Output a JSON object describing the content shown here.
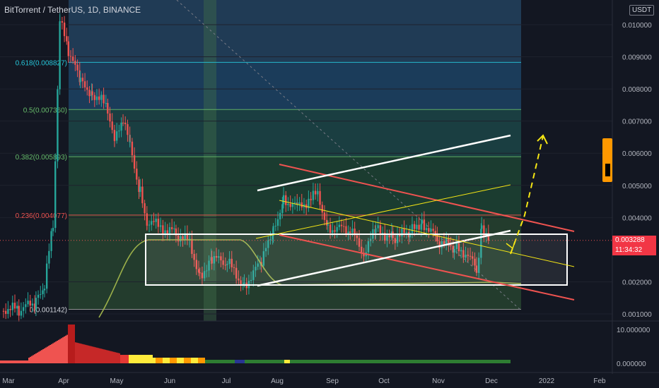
{
  "header": {
    "title": "BitTorrent / TetherUS, 1D, BINANCE",
    "quote_currency": "USDT"
  },
  "colors": {
    "background": "#131722",
    "grid": "#1e222d",
    "axis_text": "#b2b5be",
    "up": "#26a69a",
    "down": "#ef5350",
    "white": "#ffffff",
    "yellow": "#f5e614",
    "red": "#ef5350",
    "orange": "#ff9800"
  },
  "current_price": {
    "value": "0.003288",
    "countdown": "11:34:32"
  },
  "chart_data": {
    "type": "candlestick",
    "symbol": "BitTorrent / TetherUS",
    "interval": "1D",
    "exchange": "BINANCE",
    "y_axis": {
      "ticks": [
        "0.010000",
        "0.009000",
        "0.008000",
        "0.007000",
        "0.006000",
        "0.005000",
        "0.004000",
        "0.002000",
        "0.001000"
      ],
      "range": [
        0.0008,
        0.0104
      ]
    },
    "x_axis": {
      "ticks": [
        "Mar",
        "Apr",
        "May",
        "Jun",
        "Jul",
        "Aug",
        "Sep",
        "Oct",
        "Nov",
        "Dec",
        "2022",
        "Feb"
      ]
    },
    "fibonacci": [
      {
        "label": "0.618(0.008827)",
        "value": 0.008827
      },
      {
        "label": "0.5(0.007360)",
        "value": 0.00736
      },
      {
        "label": "0.382(0.005893)",
        "value": 0.005893
      },
      {
        "label": "0.236(0.004077)",
        "value": 0.004077
      },
      {
        "label": "0(0.001142)",
        "value": 0.001142
      }
    ],
    "price_path": [
      [
        "2021-03-01",
        0.00118
      ],
      [
        "2021-03-10",
        0.00112
      ],
      [
        "2021-03-20",
        0.00135
      ],
      [
        "2021-03-25",
        0.0019
      ],
      [
        "2021-03-30",
        0.0038
      ],
      [
        "2021-04-03",
        0.0101
      ],
      [
        "2021-04-08",
        0.0092
      ],
      [
        "2021-04-15",
        0.0082
      ],
      [
        "2021-04-22",
        0.0079
      ],
      [
        "2021-05-01",
        0.0074
      ],
      [
        "2021-05-05",
        0.0063
      ],
      [
        "2021-05-10",
        0.0071
      ],
      [
        "2021-05-14",
        0.0062
      ],
      [
        "2021-05-20",
        0.0048
      ],
      [
        "2021-05-24",
        0.0039
      ],
      [
        "2021-06-01",
        0.0037
      ],
      [
        "2021-06-10",
        0.0035
      ],
      [
        "2021-06-18",
        0.0032
      ],
      [
        "2021-06-24",
        0.0022
      ],
      [
        "2021-07-01",
        0.0027
      ],
      [
        "2021-07-10",
        0.0026
      ],
      [
        "2021-07-20",
        0.0019
      ],
      [
        "2021-07-30",
        0.0026
      ],
      [
        "2021-08-06",
        0.0036
      ],
      [
        "2021-08-12",
        0.0046
      ],
      [
        "2021-08-20",
        0.0043
      ],
      [
        "2021-08-28",
        0.0046
      ],
      [
        "2021-09-01",
        0.0047
      ],
      [
        "2021-09-07",
        0.0037
      ],
      [
        "2021-09-20",
        0.0036
      ],
      [
        "2021-09-28",
        0.0029
      ],
      [
        "2021-10-05",
        0.0036
      ],
      [
        "2021-10-15",
        0.0034
      ],
      [
        "2021-10-25",
        0.0035
      ],
      [
        "2021-11-01",
        0.0039
      ],
      [
        "2021-11-10",
        0.0033
      ],
      [
        "2021-11-20",
        0.003
      ],
      [
        "2021-11-28",
        0.0029
      ],
      [
        "2021-12-03",
        0.0023
      ],
      [
        "2021-12-06",
        0.0038
      ],
      [
        "2021-12-10",
        0.003288
      ]
    ],
    "oscillator": {
      "ticks": [
        "10.000000",
        "0.000000"
      ]
    }
  }
}
